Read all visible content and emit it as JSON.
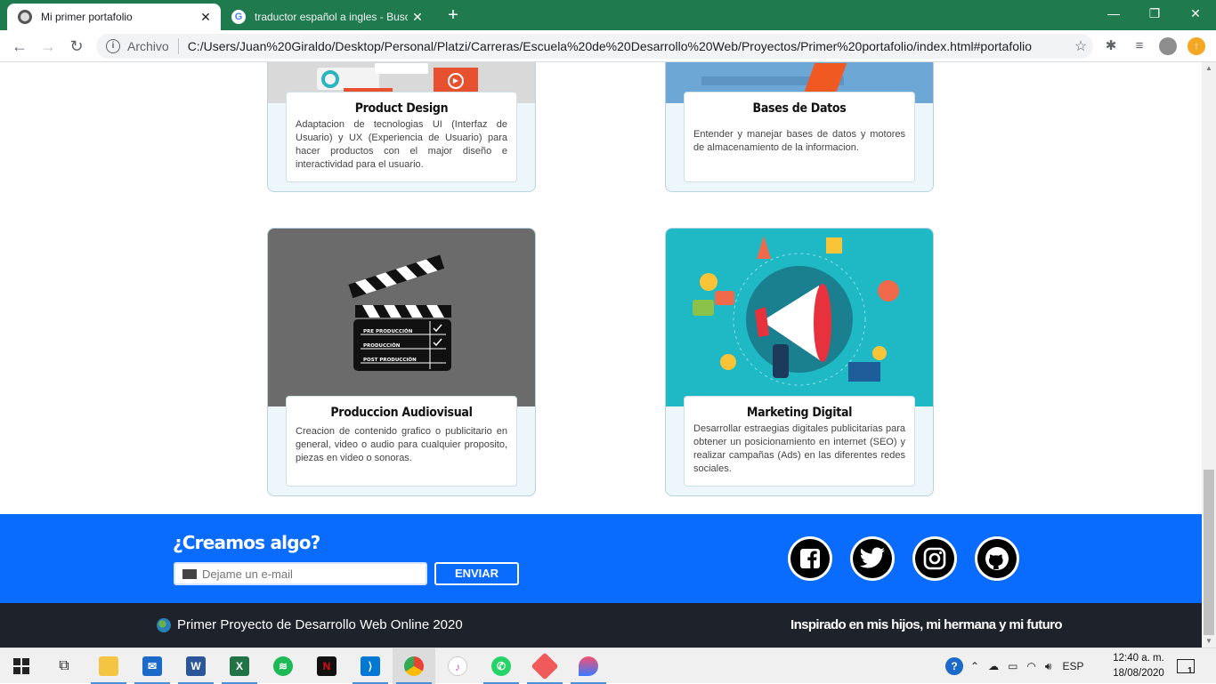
{
  "browser": {
    "tabs": [
      {
        "title": "Mi primer portafolio",
        "active": true
      },
      {
        "title": "traductor español a ingles - Busc",
        "active": false
      }
    ],
    "omnibox": {
      "scheme": "Archivo",
      "url": "C:/Users/Juan%20Giraldo/Desktop/Personal/Platzi/Carreras/Escuela%20de%20Desarrollo%20Web/Proyectos/Primer%20portafolio/index.html#portafolio"
    }
  },
  "portfolio": {
    "cards": [
      {
        "title": "Product Design",
        "description": "Adaptacion de tecnologias UI (Interfaz de Usuario) y UX (Experiencia de Usuario) para hacer productos con el major diseño e interactividad para el usuario."
      },
      {
        "title": "Bases de Datos",
        "description": "Entender y manejar bases de datos y motores de almacenamiento de la informacion."
      },
      {
        "title": "Produccion Audiovisual",
        "description": "Creacion de contenido grafico o publicitario en general, video o audio para cualquier proposito, piezas en video o sonoras."
      },
      {
        "title": "Marketing Digital",
        "description": "Desarrollar estraegias digitales publicitarias para obtener un posicionamiento en internet (SEO) y realizar campañas (Ads) en las diferentes redes sociales."
      }
    ],
    "clapper_rows": [
      "PRE PRODUCCIÓN",
      "PRODUCCIÓN",
      "POST PRODUCCIÓN"
    ]
  },
  "contact": {
    "heading": "¿Creamos algo?",
    "email_placeholder": "Dejame un e-mail",
    "send_label": "ENVIAR",
    "social": [
      "facebook-icon",
      "twitter-icon",
      "instagram-icon",
      "github-icon"
    ]
  },
  "footer": {
    "left_text": "Primer Proyecto de Desarrollo Web Online 2020",
    "right_text": "Inspirado en mis hijos, mi hermana y mi futuro"
  },
  "taskbar": {
    "language": "ESP",
    "time": "12:40 a. m.",
    "date": "18/08/2020",
    "notifications": "1"
  },
  "colors": {
    "chrome_green": "#1f7a4d",
    "contact_blue": "#0a6cff",
    "footer_dark": "#1e232b"
  }
}
